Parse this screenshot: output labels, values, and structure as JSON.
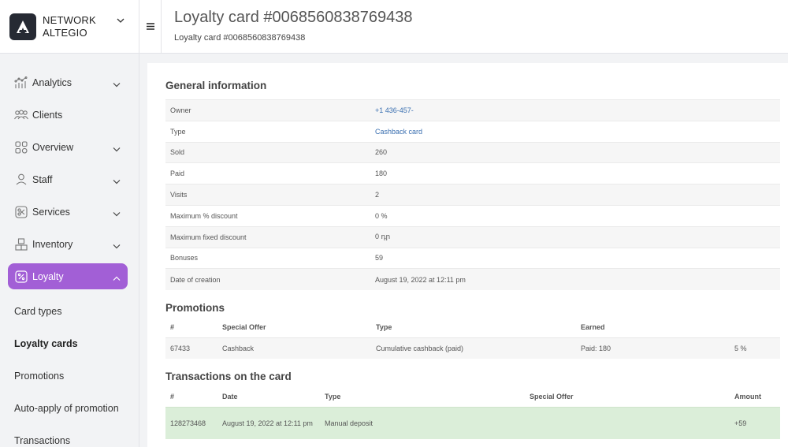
{
  "brand": {
    "name_line1": "NETWORK",
    "name_line2": "ALTEGIO"
  },
  "sidebar": {
    "items": [
      {
        "label": "Analytics",
        "icon": "analytics-icon",
        "has_chevron": true
      },
      {
        "label": "Clients",
        "icon": "clients-icon",
        "has_chevron": false
      },
      {
        "label": "Overview",
        "icon": "overview-icon",
        "has_chevron": true
      },
      {
        "label": "Staff",
        "icon": "staff-icon",
        "has_chevron": true
      },
      {
        "label": "Services",
        "icon": "scissors-icon",
        "has_chevron": true
      },
      {
        "label": "Inventory",
        "icon": "inventory-icon",
        "has_chevron": true
      },
      {
        "label": "Loyalty",
        "icon": "percent-icon",
        "has_chevron": true,
        "active": true
      }
    ],
    "loyalty_sub": [
      "Card types",
      "Loyalty cards",
      "Promotions",
      "Auto-apply of promotion",
      "Transactions"
    ],
    "active_accent": "#a25fd6"
  },
  "header": {
    "title": "Loyalty card #0068560838769438",
    "breadcrumb": "Loyalty card #0068560838769438"
  },
  "general": {
    "heading": "General information",
    "rows": [
      {
        "label": "Owner",
        "value": "+1 436-457-",
        "link": true
      },
      {
        "label": "Type",
        "value": "Cashback card",
        "link": true
      },
      {
        "label": "Sold",
        "value": "260"
      },
      {
        "label": "Paid",
        "value": "180"
      },
      {
        "label": "Visits",
        "value": "2"
      },
      {
        "label": "Maximum % discount",
        "value": "0 %"
      },
      {
        "label": "Maximum fixed discount",
        "value": "0 դր"
      },
      {
        "label": "Bonuses",
        "value": "59"
      },
      {
        "label": "Date of creation",
        "value": "August 19, 2022 at 12:11 pm"
      }
    ]
  },
  "promotions": {
    "heading": "Promotions",
    "columns": [
      "#",
      "Special Offer",
      "Type",
      "Earned",
      ""
    ],
    "rows": [
      {
        "id": "67433",
        "offer": "Cashback",
        "type": "Cumulative cashback (paid)",
        "earned": "Paid: 180",
        "pct": "5 %"
      }
    ]
  },
  "transactions": {
    "heading": "Transactions on the card",
    "columns": [
      "#",
      "Date",
      "Type",
      "Special Offer",
      "Amount"
    ],
    "rows": [
      {
        "id": "128273468",
        "date": "August 19, 2022 at 12:11 pm",
        "type": "Manual deposit",
        "offer": "",
        "amount": "+59"
      }
    ]
  }
}
